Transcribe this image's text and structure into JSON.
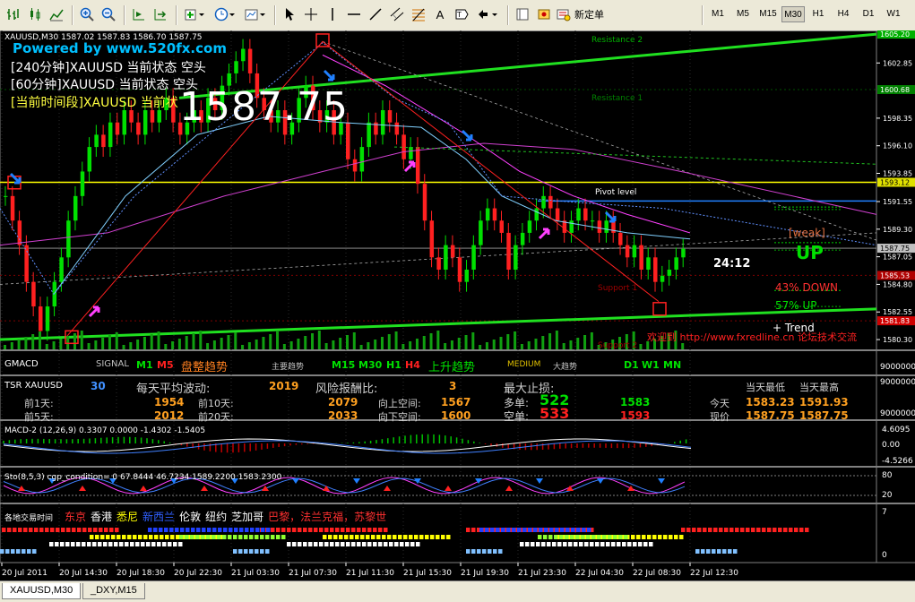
{
  "toolbar": {
    "new_order_label": "新定单",
    "timeframes": [
      "M1",
      "M5",
      "M15",
      "M30",
      "H1",
      "H4",
      "D1",
      "W1"
    ],
    "active_timeframe": "M30"
  },
  "main_chart": {
    "info": "XAUUSD,M30  1587.02 1587.83 1586.70 1587.75",
    "powered": "Powered by www.520fx.com",
    "status_lines": [
      "[240分钟]XAUUSD 当前状态 空头",
      "[60分钟]XAUUSD 当前状态 空头",
      "[当前时间段]XAUUSD 当前状"
    ],
    "big_price": "1587.75",
    "levels": {
      "resistance2": "Resistance 2",
      "resistance1": "Resistance 1",
      "pivot": "Pivot level",
      "support1": "Support 1",
      "support2": "Support 2"
    },
    "countdown": "24:12",
    "weak": "[weak]",
    "up": "UP",
    "pct_down": "43%  DOWN",
    "pct_up": "57%       UP",
    "trend": "+   Trend",
    "website": "欢迎到 http://www.fxredline.cn 论坛技术交流",
    "price_ticks": [
      "1602.85",
      "1598.35",
      "1596.10",
      "1593.85",
      "1591.55",
      "1589.30",
      "1587.05",
      "1584.80",
      "1582.55",
      "1580.30"
    ],
    "price_boxes": [
      {
        "label": "1605.20",
        "color": "#00b000"
      },
      {
        "label": "1600.68",
        "color": "#008000"
      },
      {
        "label": "1593.12",
        "color": "#e0e000"
      },
      {
        "label": "1587.75",
        "color": "#c0c0c0"
      },
      {
        "label": "1585.53",
        "color": "#b00000"
      },
      {
        "label": "1581.83",
        "color": "#d00000"
      }
    ]
  },
  "gmacd": {
    "title": "GMACD",
    "signal": "SIGNAL",
    "tf1": "M1",
    "tf2": "M5",
    "trend1": "盘整趋势",
    "mid1": "主要趋势",
    "tf3": "M15",
    "tf4": "M30",
    "tf5": "H1",
    "tf6": "H4",
    "trend2": "上升趋势",
    "medium": "MEDIUM",
    "big": "大趋势",
    "tf7": "D1",
    "tf8": "W1",
    "tf9": "MN",
    "scale": "9000000"
  },
  "tsr": {
    "title": "TSR XAUUSD",
    "period": "30",
    "daily_move": "每天平均波动:",
    "daily_move_val": "2019",
    "risk": "风险报酬比:",
    "risk_val": "3",
    "max_stop": "最大止损:",
    "today_low_h": "当天最低",
    "today_high_h": "当天最高",
    "r1_l": "前1天:",
    "r1_v": "1954",
    "r10_l": "前10天:",
    "r10_v": "2079",
    "up_l": "向上空间:",
    "up_v": "1567",
    "long_l": "多单:",
    "long_v": "522",
    "long_p": "1583",
    "today_l": "今天",
    "today_low": "1583.23",
    "today_high": "1591.93",
    "r5_l": "前5天:",
    "r5_v": "2012",
    "r20_l": "前20天:",
    "r20_v": "2033",
    "down_l": "向下空间:",
    "down_v": "1600",
    "short_l": "空单:",
    "short_v": "533",
    "short_p": "1593",
    "now_l": "现价",
    "now_low": "1587.75",
    "now_high": "1587.75",
    "scale_top": "9000000",
    "scale_bot": "9000000"
  },
  "macd": {
    "title": "MACD-2 (12,26,9) 0.3307 0.0000 -1.4302 -1.5405",
    "scale_top": "4.6095",
    "scale_mid": "0.00",
    "scale_bot": "-4.5266"
  },
  "stoch": {
    "title": "Sto(8,5,3) cgp_condition=  0  67.8444 46.7234 1589.2200 1583.2300",
    "scale_top": "80",
    "scale_bot": "20"
  },
  "sessions": {
    "title": "各地交易时间",
    "names": [
      {
        "label": "东京",
        "color": "#ff3030"
      },
      {
        "label": "香港",
        "color": "#ffffff"
      },
      {
        "label": "悉尼",
        "color": "#ffff00"
      },
      {
        "label": "新西兰",
        "color": "#3060ff"
      },
      {
        "label": "伦敦",
        "color": "#ffffff"
      },
      {
        "label": "纽约",
        "color": "#ffffff"
      },
      {
        "label": "芝加哥",
        "color": "#ffffff"
      },
      {
        "label": "巴黎，法兰克福，苏黎世",
        "color": "#ff3030"
      }
    ],
    "scale_top": "7",
    "scale_bot": "0"
  },
  "time_axis": [
    "20 Jul 2011",
    "20 Jul 14:30",
    "20 Jul 18:30",
    "20 Jul 22:30",
    "21 Jul 03:30",
    "21 Jul 07:30",
    "21 Jul 11:30",
    "21 Jul 15:30",
    "21 Jul 19:30",
    "21 Jul 23:30",
    "22 Jul 04:30",
    "22 Jul 08:30",
    "22 Jul 12:30"
  ],
  "tabs": [
    "XAUUSD,M30",
    "_DXY,M15"
  ],
  "colors": {
    "bull": "#00e000",
    "bear": "#ff2020",
    "grid": "#404040",
    "panel_border": "#808080"
  }
}
